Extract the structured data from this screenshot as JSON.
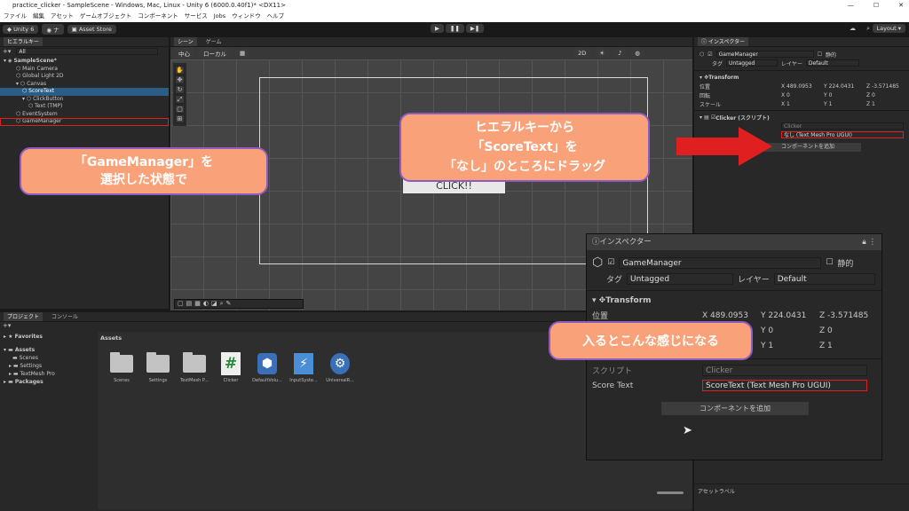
{
  "window": {
    "title": "practice_clicker - SampleScene - Windows, Mac, Linux - Unity 6 (6000.0.40f1)* <DX11>",
    "controls": [
      "—",
      "☐",
      "✕"
    ]
  },
  "menu": [
    "ファイル",
    "編集",
    "アセット",
    "ゲームオブジェクト",
    "コンポーネント",
    "サービス",
    "Jobs",
    "ウィンドウ",
    "ヘルプ"
  ],
  "toolbar": {
    "unity_label": "Unity 6",
    "account_label": "ナ",
    "store_label": "Asset Store",
    "layout_label": "Layout"
  },
  "hierarchy": {
    "tab": "ヒエラルキー",
    "search_placeholder": "All",
    "rows": [
      {
        "label": "SampleScene*",
        "indent": 0,
        "selected": false,
        "outlined": false
      },
      {
        "label": "Main Camera",
        "indent": 2,
        "selected": false,
        "outlined": false
      },
      {
        "label": "Global Light 2D",
        "indent": 2,
        "selected": false,
        "outlined": false
      },
      {
        "label": "Canvas",
        "indent": 2,
        "selected": false,
        "outlined": false
      },
      {
        "label": "ScoreText",
        "indent": 3,
        "selected": true,
        "outlined": false
      },
      {
        "label": "ClickButton",
        "indent": 3,
        "selected": false,
        "outlined": false
      },
      {
        "label": "Text (TMP)",
        "indent": 4,
        "selected": false,
        "outlined": false
      },
      {
        "label": "EventSystem",
        "indent": 2,
        "selected": false,
        "outlined": false
      },
      {
        "label": "GameManager",
        "indent": 2,
        "selected": false,
        "outlined": true
      }
    ]
  },
  "scene": {
    "tabs": [
      "シーン",
      "ゲーム"
    ],
    "pivot_label": "中心",
    "space_label": "ローカル",
    "mode_2d": "2D",
    "button_text": "CLICK!!"
  },
  "project": {
    "tabs": [
      "プロジェクト",
      "コンソール"
    ],
    "tree": [
      "Favorites",
      "Assets",
      "Scenes",
      "Settings",
      "TextMesh Pro",
      "Packages"
    ],
    "breadcrumb": "Assets",
    "assets": [
      {
        "label": "Scenes",
        "icon": "folder-icon"
      },
      {
        "label": "Settings",
        "icon": "folder-icon"
      },
      {
        "label": "TextMesh P...",
        "icon": "folder-icon"
      },
      {
        "label": "Clicker",
        "icon": "csharp-script-icon"
      },
      {
        "label": "DefaultVolu...",
        "icon": "volume-profile-icon"
      },
      {
        "label": "InputSyste...",
        "icon": "input-actions-icon"
      },
      {
        "label": "UniversalR...",
        "icon": "render-pipeline-icon"
      }
    ]
  },
  "inspector": {
    "tab": "インスペクター",
    "object_name": "GameManager",
    "static_label": "静的",
    "tag_label": "タグ",
    "tag_value": "Untagged",
    "layer_label": "レイヤー",
    "layer_value": "Default",
    "transform_title": "Transform",
    "position_label": "位置",
    "rotation_label": "回転",
    "scale_label": "スケール",
    "position": {
      "x": "489.0953",
      "y": "224.0431",
      "z": "-3.571485"
    },
    "rotation": {
      "x": "0",
      "y": "0",
      "z": "0"
    },
    "scale": {
      "x": "1",
      "y": "1",
      "z": "1"
    },
    "clicker_title": "Clicker (スクリプト)",
    "script_value": "Clicker",
    "score_field_value": "なし (Text Mesh Pro UGUI)",
    "add_component": "コンポーネントを追加",
    "asset_label": "アセットラベル"
  },
  "zoomed_inspector": {
    "tab": "インスペクター",
    "object_name": "GameManager",
    "static_label": "静的",
    "tag_label": "タグ",
    "tag_value": "Untagged",
    "layer_label": "レイヤー",
    "layer_value": "Default",
    "transform_title": "Transform",
    "position_label": "位置",
    "position": {
      "x": "489.0953",
      "y": "224.0431",
      "z": "-3.571485"
    },
    "rotation": {
      "x": "0",
      "y": "0",
      "z": "0"
    },
    "scale": {
      "x": "1",
      "y": "1",
      "z": "1"
    },
    "script_label": "スクリプト",
    "script_value": "Clicker",
    "score_label": "Score Text",
    "score_value": "ScoreText (Text Mesh Pro UGUI)",
    "add_component": "コンポーネントを追加"
  },
  "callouts": {
    "select_line1": "「GameManager」を",
    "select_line2": "選択した状態で",
    "drag_line1": "ヒエラルキーから",
    "drag_line2": "「ScoreText」を",
    "drag_line3": "「なし」のところにドラッグ",
    "result": "入るとこんな感じになる"
  },
  "colors": {
    "callout_fill": "#f9a27a",
    "callout_border": "#8e5bbf",
    "highlight_red": "#e02020",
    "selection_blue": "#2c5d87"
  }
}
